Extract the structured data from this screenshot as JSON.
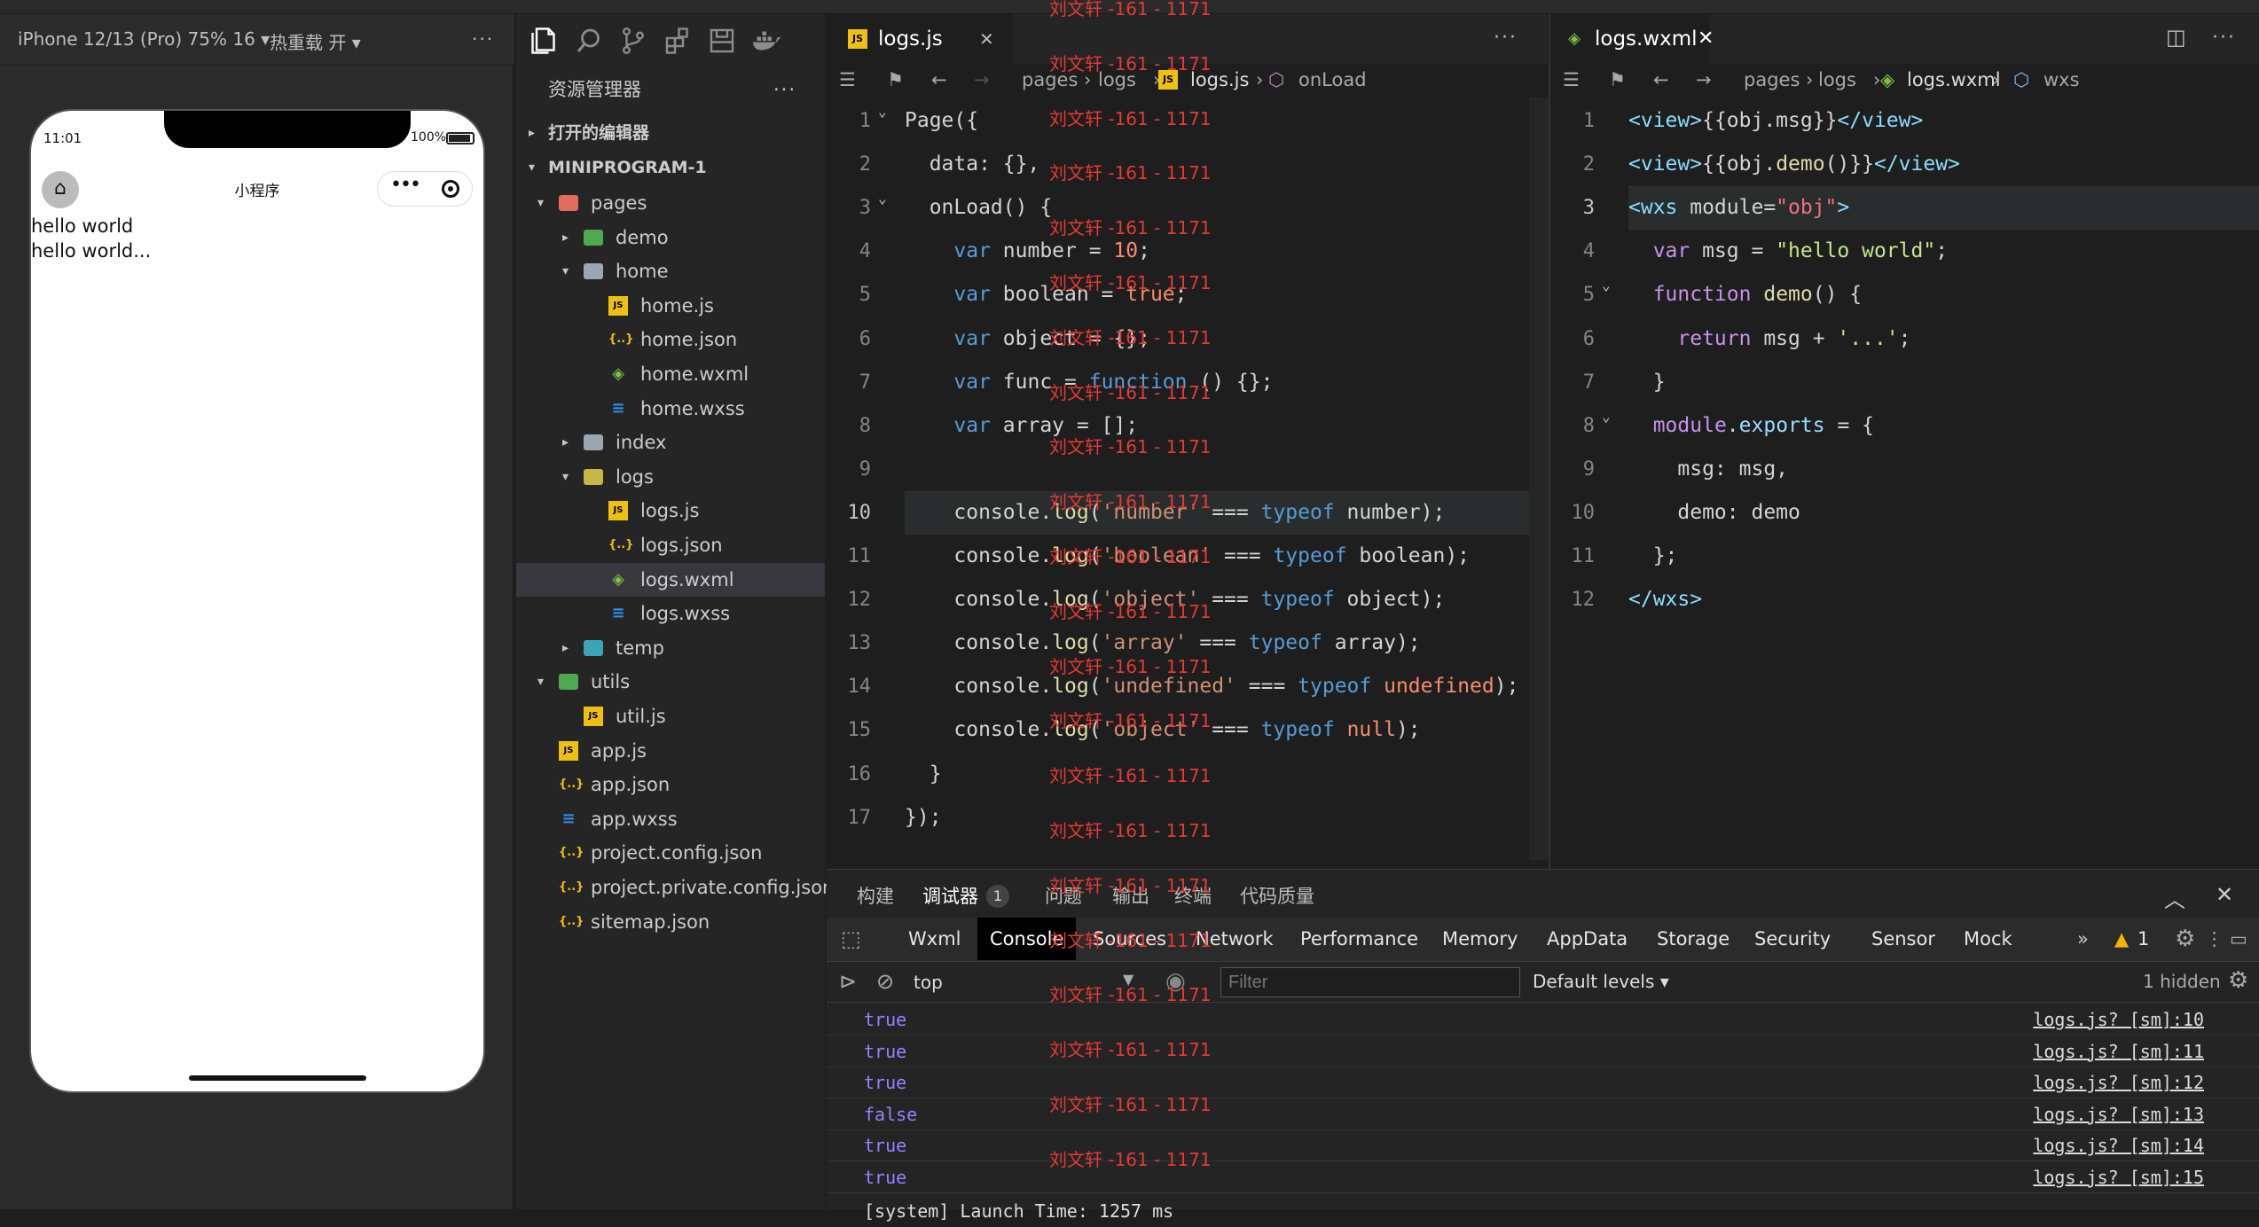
{
  "simulator": {
    "device": "iPhone 12/13 (Pro) 75% 16 ▾",
    "hot_reload": "热重载 开 ▾",
    "more": "···",
    "time": "11:01",
    "battery": "100%",
    "page_title": "小程序",
    "capsule_more": "•••",
    "content": [
      "hello world",
      "hello world..."
    ]
  },
  "explorer": {
    "title": "资源管理器",
    "more": "···",
    "sections": {
      "open_editors": "打开的编辑器",
      "project": "MINIPROGRAM-1"
    },
    "tree": [
      {
        "label": "pages",
        "kind": "folder-red",
        "depth": 1,
        "arrow": "▾"
      },
      {
        "label": "demo",
        "kind": "folder-green",
        "depth": 2,
        "arrow": "▸"
      },
      {
        "label": "home",
        "kind": "folder",
        "depth": 2,
        "arrow": "▾"
      },
      {
        "label": "home.js",
        "kind": "js",
        "depth": 3
      },
      {
        "label": "home.json",
        "kind": "json",
        "depth": 3
      },
      {
        "label": "home.wxml",
        "kind": "wxml",
        "depth": 3
      },
      {
        "label": "home.wxss",
        "kind": "wxss",
        "depth": 3
      },
      {
        "label": "index",
        "kind": "folder",
        "depth": 2,
        "arrow": "▸"
      },
      {
        "label": "logs",
        "kind": "folder-yellow",
        "depth": 2,
        "arrow": "▾"
      },
      {
        "label": "logs.js",
        "kind": "js",
        "depth": 3
      },
      {
        "label": "logs.json",
        "kind": "json",
        "depth": 3
      },
      {
        "label": "logs.wxml",
        "kind": "wxml",
        "depth": 3,
        "selected": true
      },
      {
        "label": "logs.wxss",
        "kind": "wxss",
        "depth": 3
      },
      {
        "label": "temp",
        "kind": "folder-teal",
        "depth": 2,
        "arrow": "▸"
      },
      {
        "label": "utils",
        "kind": "folder-green",
        "depth": 1,
        "arrow": "▾"
      },
      {
        "label": "util.js",
        "kind": "js",
        "depth": 2
      },
      {
        "label": "app.js",
        "kind": "js",
        "depth": 1
      },
      {
        "label": "app.json",
        "kind": "json",
        "depth": 1
      },
      {
        "label": "app.wxss",
        "kind": "wxss",
        "depth": 1
      },
      {
        "label": "project.config.json",
        "kind": "json",
        "depth": 1
      },
      {
        "label": "project.private.config.json",
        "kind": "json",
        "depth": 1
      },
      {
        "label": "sitemap.json",
        "kind": "json",
        "depth": 1
      }
    ]
  },
  "editor_left": {
    "tab": "logs.js",
    "close": "✕",
    "more": "···",
    "breadcrumb": [
      "pages",
      "logs",
      "logs.js",
      "onLoad"
    ],
    "lines": [
      [
        [
          "Page({",
          "pl"
        ]
      ],
      [
        [
          "  data: {},",
          "pl"
        ]
      ],
      [
        [
          "  onLoad() {",
          "pl"
        ]
      ],
      [
        [
          "    ",
          "pl"
        ],
        [
          "var",
          "kw"
        ],
        [
          " number = ",
          "pl"
        ],
        [
          "10",
          "or"
        ],
        [
          ";",
          "pl"
        ]
      ],
      [
        [
          "    ",
          "pl"
        ],
        [
          "var",
          "kw"
        ],
        [
          " boolean = ",
          "pl"
        ],
        [
          "true",
          "or"
        ],
        [
          ";",
          "pl"
        ]
      ],
      [
        [
          "    ",
          "pl"
        ],
        [
          "var",
          "kw"
        ],
        [
          " object = {};",
          "pl"
        ]
      ],
      [
        [
          "    ",
          "pl"
        ],
        [
          "var",
          "kw"
        ],
        [
          " func = ",
          "pl"
        ],
        [
          "function",
          "kw"
        ],
        [
          " () {};",
          "pl"
        ]
      ],
      [
        [
          "    ",
          "pl"
        ],
        [
          "var",
          "kw"
        ],
        [
          " array = [];",
          "pl"
        ]
      ],
      [
        [
          "",
          "pl"
        ]
      ],
      [
        [
          "    console.",
          "pl"
        ],
        [
          "log",
          "fn"
        ],
        [
          "(",
          "pl"
        ],
        [
          "'number'",
          "str"
        ],
        [
          " === ",
          "pl"
        ],
        [
          "typeof",
          "kw"
        ],
        [
          " number);",
          "pl"
        ]
      ],
      [
        [
          "    console.",
          "pl"
        ],
        [
          "log",
          "fn"
        ],
        [
          "(",
          "pl"
        ],
        [
          "'boolean'",
          "str"
        ],
        [
          " === ",
          "pl"
        ],
        [
          "typeof",
          "kw"
        ],
        [
          " boolean);",
          "pl"
        ]
      ],
      [
        [
          "    console.",
          "pl"
        ],
        [
          "log",
          "fn"
        ],
        [
          "(",
          "pl"
        ],
        [
          "'object'",
          "str"
        ],
        [
          " === ",
          "pl"
        ],
        [
          "typeof",
          "kw"
        ],
        [
          " object);",
          "pl"
        ]
      ],
      [
        [
          "    console.",
          "pl"
        ],
        [
          "log",
          "fn"
        ],
        [
          "(",
          "pl"
        ],
        [
          "'array'",
          "str"
        ],
        [
          " === ",
          "pl"
        ],
        [
          "typeof",
          "kw"
        ],
        [
          " array);",
          "pl"
        ]
      ],
      [
        [
          "    console.",
          "pl"
        ],
        [
          "log",
          "fn"
        ],
        [
          "(",
          "pl"
        ],
        [
          "'undefined'",
          "str"
        ],
        [
          " === ",
          "pl"
        ],
        [
          "typeof",
          "kw"
        ],
        [
          " ",
          "pl"
        ],
        [
          "undefined",
          "or"
        ],
        [
          ");",
          "pl"
        ]
      ],
      [
        [
          "    console.",
          "pl"
        ],
        [
          "log",
          "fn"
        ],
        [
          "(",
          "pl"
        ],
        [
          "'object'",
          "str"
        ],
        [
          " === ",
          "pl"
        ],
        [
          "typeof",
          "kw"
        ],
        [
          " ",
          "pl"
        ],
        [
          "null",
          "or"
        ],
        [
          ");",
          "pl"
        ]
      ],
      [
        [
          "  }",
          "pl"
        ]
      ],
      [
        [
          "});",
          "pl"
        ]
      ]
    ],
    "active_line": 10
  },
  "editor_right": {
    "tab": "logs.wxml",
    "close": "✕",
    "more": "···",
    "breadcrumb": [
      "pages",
      "logs",
      "logs.wxml",
      "wxs"
    ],
    "lines": [
      [
        [
          "<view>",
          "cy"
        ],
        [
          "{{obj.msg}}",
          "pl"
        ],
        [
          "</view>",
          "cy"
        ]
      ],
      [
        [
          "<view>",
          "cy"
        ],
        [
          "{{obj.",
          "pl"
        ],
        [
          "demo",
          "fn"
        ],
        [
          "()}}",
          "pl"
        ],
        [
          "</view>",
          "cy"
        ]
      ],
      [
        [
          "<wxs",
          "cy"
        ],
        [
          " module=",
          "pl"
        ],
        [
          "\"obj\"",
          "rd"
        ],
        [
          ">",
          "cy"
        ]
      ],
      [
        [
          "  ",
          "pl"
        ],
        [
          "var",
          "pu"
        ],
        [
          " msg = ",
          "pl"
        ],
        [
          "\"hello world\"",
          "gr"
        ],
        [
          ";",
          "pl"
        ]
      ],
      [
        [
          "  ",
          "pl"
        ],
        [
          "function",
          "pu"
        ],
        [
          " ",
          "pl"
        ],
        [
          "demo",
          "fn"
        ],
        [
          "() {",
          "pl"
        ]
      ],
      [
        [
          "    ",
          "pl"
        ],
        [
          "return",
          "pu"
        ],
        [
          " msg + ",
          "pl"
        ],
        [
          "'...'",
          "gr"
        ],
        [
          ";",
          "pl"
        ]
      ],
      [
        [
          "  }",
          "pl"
        ]
      ],
      [
        [
          "  ",
          "pl"
        ],
        [
          "module",
          "pu"
        ],
        [
          ".",
          "pl"
        ],
        [
          "exports",
          "vr"
        ],
        [
          " = {",
          "pl"
        ]
      ],
      [
        [
          "    msg: msg,",
          "pl"
        ]
      ],
      [
        [
          "    demo: demo",
          "pl"
        ]
      ],
      [
        [
          "  };",
          "pl"
        ]
      ],
      [
        [
          "</wxs>",
          "cy"
        ]
      ]
    ],
    "active_line": 3
  },
  "devtools": {
    "tabs": [
      "构建",
      "调试器",
      "问题",
      "输出",
      "终端",
      "代码质量"
    ],
    "debugger_badge": "1",
    "panels": [
      "Wxml",
      "Console",
      "Sources",
      "Network",
      "Performance",
      "Memory",
      "AppData",
      "Storage",
      "Security",
      "Sensor",
      "Mock"
    ],
    "more_panels": "»",
    "warnings": "1",
    "context": "top",
    "filter_placeholder": "Filter",
    "levels": "Default levels",
    "hidden": "1 hidden",
    "logs": [
      {
        "value": "true",
        "source": "logs.js? [sm]:10"
      },
      {
        "value": "true",
        "source": "logs.js? [sm]:11"
      },
      {
        "value": "true",
        "source": "logs.js? [sm]:12"
      },
      {
        "value": "false",
        "source": "logs.js? [sm]:13"
      },
      {
        "value": "true",
        "source": "logs.js? [sm]:14"
      },
      {
        "value": "true",
        "source": "logs.js? [sm]:15"
      }
    ],
    "last_log": "[system] Launch Time: 1257 ms"
  },
  "watermark": "刘文轩 -161 - 1171"
}
